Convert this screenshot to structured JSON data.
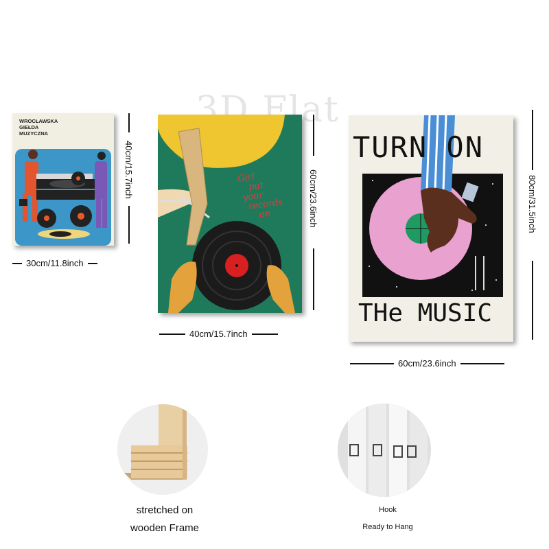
{
  "watermark": "3D Flat",
  "posters": {
    "small": {
      "title_lines": [
        "WROCŁAWSKA",
        "GIEŁDA",
        "MUZYCZNA"
      ],
      "width_label": "30cm/11.8inch",
      "height_label": "40cm/15.7inch"
    },
    "medium": {
      "script_lines": [
        "Girl",
        "put",
        "your",
        "records",
        "on"
      ],
      "width_label": "40cm/15.7inch",
      "height_label": "60cm/23.6inch"
    },
    "large": {
      "top_text": "TURN ON",
      "bottom_text": "THe MUSIC",
      "width_label": "60cm/23.6inch",
      "height_label": "80cm/31.5inch"
    }
  },
  "features": {
    "frame_line1": "stretched on",
    "frame_line2": "wooden Frame",
    "hook_line1": "Hook",
    "hook_line2": "Ready to Hang"
  },
  "colors": {
    "small_bg": "#f1eee2",
    "small_panel": "#3d96c8",
    "medium_bg": "#1f7a5c",
    "medium_yellow": "#efc530",
    "large_bg": "#f2f0e6",
    "large_pink": "#e9a1cf"
  }
}
